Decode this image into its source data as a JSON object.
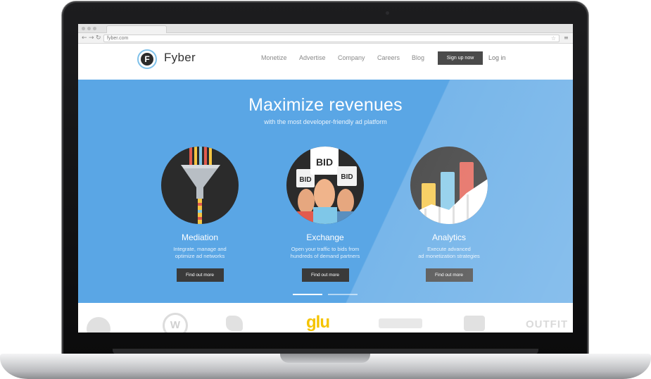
{
  "browser": {
    "url": "fyber.com"
  },
  "site": {
    "brand": "Fyber",
    "nav": [
      "Monetize",
      "Advertise",
      "Company",
      "Careers",
      "Blog"
    ],
    "signup_label": "Sign up now",
    "login_label": "Log in"
  },
  "hero": {
    "title": "Maximize revenues",
    "subtitle": "with the most developer-friendly ad platform",
    "features": [
      {
        "title": "Mediation",
        "desc1": "Integrate, manage and",
        "desc2": "optimize ad networks",
        "button": "Find out more",
        "icon": "funnel-icon"
      },
      {
        "title": "Exchange",
        "desc1": "Open your traffic to bids from",
        "desc2": "hundreds of demand partners",
        "button": "Find out more",
        "icon": "bid-paddles-icon",
        "paddle_text": "BID"
      },
      {
        "title": "Analytics",
        "desc1": "Execute advanced",
        "desc2": "ad monetization strategies",
        "button": "Find out more",
        "icon": "bar-chart-icon"
      }
    ]
  },
  "partners": {
    "glu_label": "glu",
    "outfit_label": "OUTFIT"
  },
  "colors": {
    "hero_blue": "#5aa6e5",
    "button_dark": "#3a3a3a",
    "logo_ring": "#7fc1ea",
    "glu_yellow": "#f5c400"
  }
}
